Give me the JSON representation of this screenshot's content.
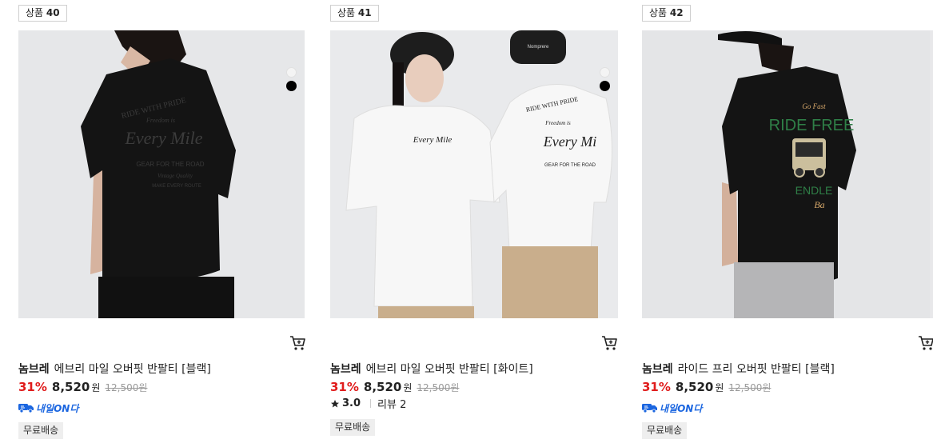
{
  "products": [
    {
      "badge_prefix": "상품",
      "badge_num": "40",
      "brand": "놈브레",
      "name": "에브리 마일 오버핏 반팔티 [블랙]",
      "discount": "31%",
      "sale_price": "8,520",
      "currency": "원",
      "original_price": "12,500원",
      "delivery_label": "내일ON다",
      "free_shipping": "무료배송",
      "swatches": [
        "white",
        "black"
      ],
      "shirt_color": "#141414",
      "print_text_1": "RIDE WITH PRIDE",
      "print_text_2": "Freedom is",
      "print_text_3": "Every Mile",
      "print_text_4": "GEAR FOR THE ROAD",
      "print_text_5": "Vintage Quality",
      "print_text_6": "MAKE EVERY ROUTE"
    },
    {
      "badge_prefix": "상품",
      "badge_num": "41",
      "brand": "놈브레",
      "name": "에브리 마일 오버핏 반팔티 [화이트]",
      "discount": "31%",
      "sale_price": "8,520",
      "currency": "원",
      "original_price": "12,500원",
      "rating": "3.0",
      "review_label": "리뷰 2",
      "free_shipping": "무료배송",
      "swatches": [
        "white",
        "black"
      ],
      "shirt_color": "#f7f7f7",
      "print_text_1": "RIDE WITH PRIDE",
      "print_text_2": "Freedom is",
      "print_text_3": "Every Mi",
      "print_text_4": "GEAR FOR THE ROAD",
      "beanie_text": "Nomprere"
    },
    {
      "badge_prefix": "상품",
      "badge_num": "42",
      "brand": "놈브레",
      "name": "라이드 프리 오버핏 반팔티 [블랙]",
      "discount": "31%",
      "sale_price": "8,520",
      "currency": "원",
      "original_price": "12,500원",
      "delivery_label": "내일ON다",
      "free_shipping": "무료배송",
      "shirt_color": "#141414",
      "print_text_1": "Go Fast",
      "print_text_2": "RIDE FREE",
      "print_text_3": "ENDLE",
      "print_text_4": "Ba"
    }
  ],
  "icons": {
    "cart": "cart-icon",
    "star": "star-icon",
    "delivery": "delivery-truck-icon"
  },
  "colors": {
    "discount": "#e01c1c",
    "delivery_blue": "#1b66e0",
    "shipping_bg": "#eeeeee"
  }
}
